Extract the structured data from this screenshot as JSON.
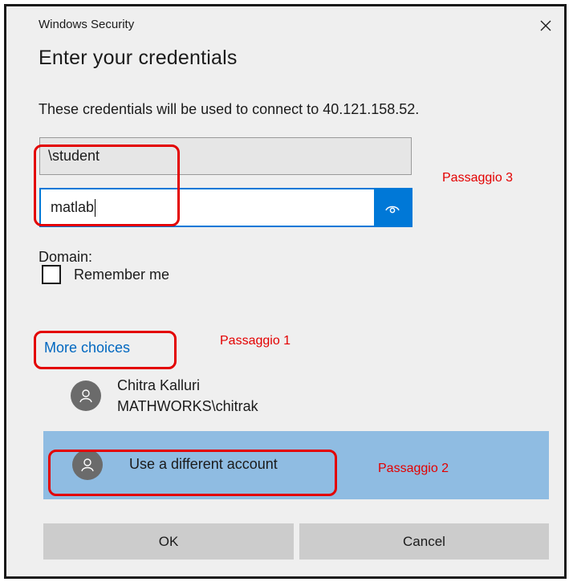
{
  "dialog": {
    "window_title": "Windows Security",
    "close_icon": "close-icon",
    "heading": "Enter your credentials",
    "description": "These credentials will be used to connect to 40.121.158.52.",
    "username_value": "\\student",
    "password_value": "matlab",
    "reveal_icon": "eye-icon",
    "domain_label": "Domain:",
    "remember_label": "Remember me",
    "remember_checked": false,
    "more_choices_label": "More choices",
    "account": {
      "name": "Chitra Kalluri",
      "user": "MATHWORKS\\chitrak",
      "avatar_icon": "person-icon"
    },
    "different_account_label": "Use a different account",
    "ok_label": "OK",
    "cancel_label": "Cancel"
  },
  "annotations": {
    "step1": "Passaggio 1",
    "step2": "Passaggio 2",
    "step3": "Passaggio 3",
    "color": "#e30000"
  },
  "colors": {
    "accent": "#0078d7",
    "link": "#0067c0",
    "selected_row": "#8fbce2",
    "dialog_bg": "#efefef",
    "button_bg": "#cccccc"
  }
}
